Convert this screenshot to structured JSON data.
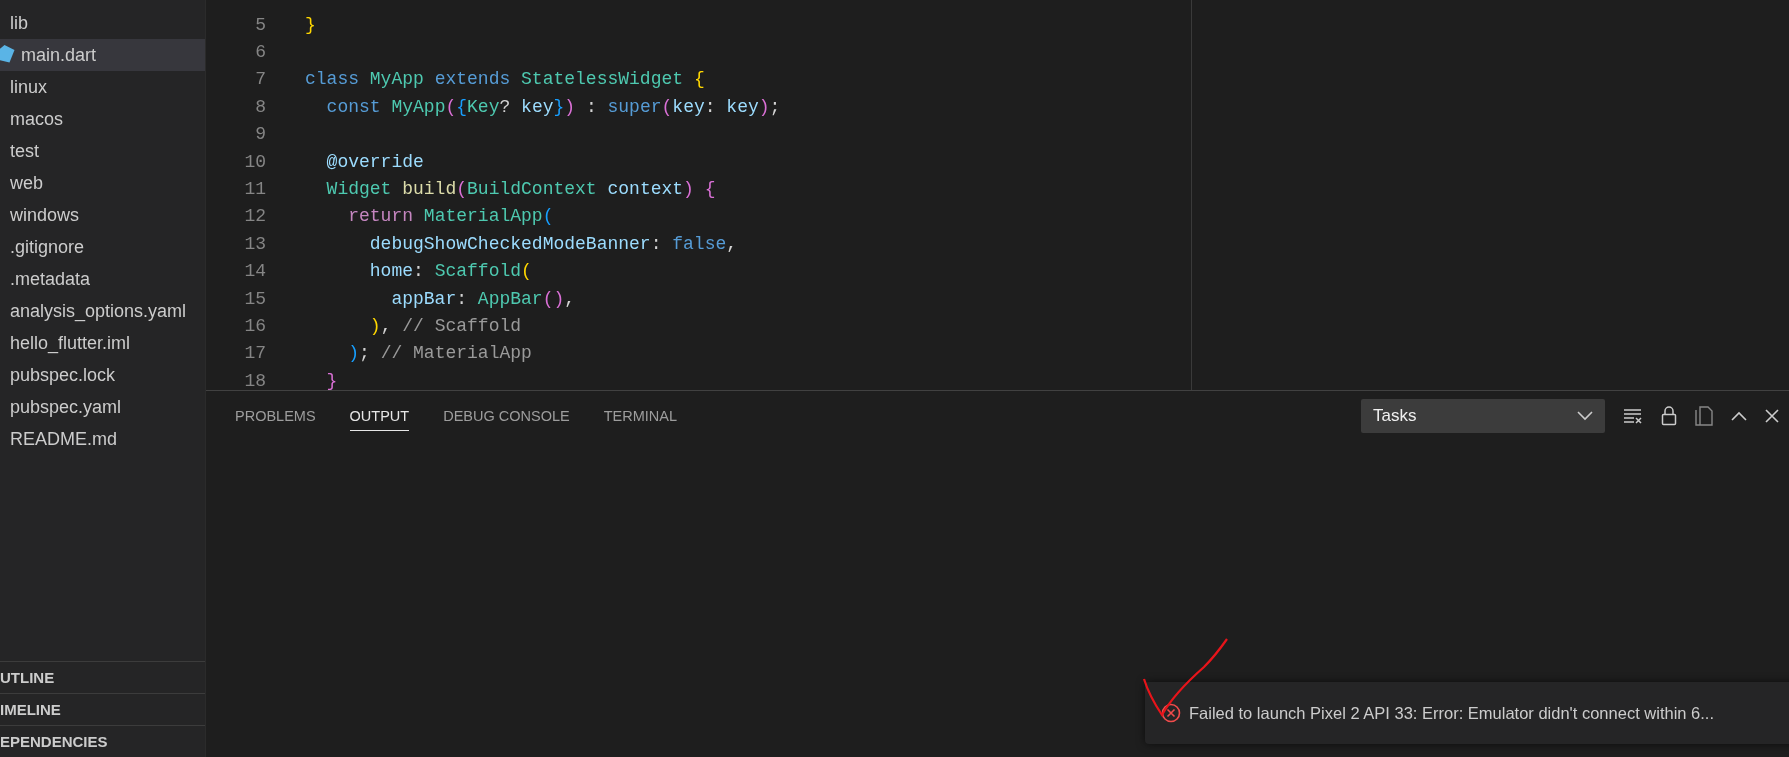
{
  "explorer": {
    "items": [
      {
        "label": "lib",
        "kind": "folder",
        "selected": false
      },
      {
        "label": "main.dart",
        "kind": "dart",
        "selected": true
      },
      {
        "label": "linux",
        "kind": "folder",
        "selected": false
      },
      {
        "label": "macos",
        "kind": "folder",
        "selected": false
      },
      {
        "label": "test",
        "kind": "folder",
        "selected": false
      },
      {
        "label": "web",
        "kind": "folder",
        "selected": false
      },
      {
        "label": "windows",
        "kind": "folder",
        "selected": false
      },
      {
        "label": ".gitignore",
        "kind": "file",
        "selected": false
      },
      {
        "label": ".metadata",
        "kind": "file",
        "selected": false
      },
      {
        "label": "analysis_options.yaml",
        "kind": "file",
        "selected": false
      },
      {
        "label": "hello_flutter.iml",
        "kind": "file",
        "selected": false
      },
      {
        "label": "pubspec.lock",
        "kind": "file",
        "selected": false
      },
      {
        "label": "pubspec.yaml",
        "kind": "file",
        "selected": false
      },
      {
        "label": "README.md",
        "kind": "file",
        "selected": false
      }
    ],
    "sections": [
      "UTLINE",
      "IMELINE",
      "EPENDENCIES"
    ]
  },
  "editor": {
    "lines": [
      {
        "number": "5",
        "tokens": [
          {
            "text": "}",
            "kind": "b1"
          }
        ]
      },
      {
        "number": "6"
      },
      {
        "number": "7",
        "tokens": [
          {
            "text": "class ",
            "kind": "keyword"
          },
          {
            "text": "MyApp ",
            "kind": "type"
          },
          {
            "text": "extends ",
            "kind": "keyword"
          },
          {
            "text": "StatelessWidget ",
            "kind": "type"
          },
          {
            "text": "{",
            "kind": "b1"
          }
        ]
      },
      {
        "number": "8",
        "tokens": [
          {
            "text": "  const ",
            "kind": "keyword"
          },
          {
            "text": "MyApp",
            "kind": "type"
          },
          {
            "text": "(",
            "kind": "b2"
          },
          {
            "text": "{",
            "kind": "b3"
          },
          {
            "text": "Key",
            "kind": "type"
          },
          {
            "text": "? ",
            "kind": "plain"
          },
          {
            "text": "key",
            "kind": "var"
          },
          {
            "text": "}",
            "kind": "b3"
          },
          {
            "text": ")",
            "kind": "b2"
          },
          {
            "text": " : ",
            "kind": "plain"
          },
          {
            "text": "super",
            "kind": "keyword"
          },
          {
            "text": "(",
            "kind": "b2"
          },
          {
            "text": "key",
            "kind": "var"
          },
          {
            "text": ": ",
            "kind": "plain"
          },
          {
            "text": "key",
            "kind": "var"
          },
          {
            "text": ")",
            "kind": "b2"
          },
          {
            "text": ";",
            "kind": "plain"
          }
        ]
      },
      {
        "number": "9"
      },
      {
        "number": "10",
        "tokens": [
          {
            "text": "  @override",
            "kind": "var"
          }
        ]
      },
      {
        "number": "11",
        "tokens": [
          {
            "text": "  Widget ",
            "kind": "type"
          },
          {
            "text": "build",
            "kind": "func"
          },
          {
            "text": "(",
            "kind": "b2"
          },
          {
            "text": "BuildContext ",
            "kind": "type"
          },
          {
            "text": "context",
            "kind": "var"
          },
          {
            "text": ")",
            "kind": "b2"
          },
          {
            "text": " {",
            "kind": "b2"
          }
        ]
      },
      {
        "number": "12",
        "tokens": [
          {
            "text": "    return ",
            "kind": "control"
          },
          {
            "text": "MaterialApp",
            "kind": "type"
          },
          {
            "text": "(",
            "kind": "b3"
          }
        ]
      },
      {
        "number": "13",
        "tokens": [
          {
            "text": "      debugShowCheckedModeBanner",
            "kind": "var"
          },
          {
            "text": ": ",
            "kind": "plain"
          },
          {
            "text": "false",
            "kind": "keyword"
          },
          {
            "text": ",",
            "kind": "plain"
          }
        ]
      },
      {
        "number": "14",
        "tokens": [
          {
            "text": "      home",
            "kind": "var"
          },
          {
            "text": ": ",
            "kind": "plain"
          },
          {
            "text": "Scaffold",
            "kind": "type"
          },
          {
            "text": "(",
            "kind": "b1"
          }
        ]
      },
      {
        "number": "15",
        "tokens": [
          {
            "text": "        appBar",
            "kind": "var"
          },
          {
            "text": ": ",
            "kind": "plain"
          },
          {
            "text": "AppBar",
            "kind": "type"
          },
          {
            "text": "()",
            "kind": "b2"
          },
          {
            "text": ",",
            "kind": "plain"
          }
        ]
      },
      {
        "number": "16",
        "tokens": [
          {
            "text": "      )",
            "kind": "b1"
          },
          {
            "text": ", ",
            "kind": "plain"
          },
          {
            "text": "// Scaffold",
            "kind": "comment"
          }
        ]
      },
      {
        "number": "17",
        "tokens": [
          {
            "text": "    )",
            "kind": "b3"
          },
          {
            "text": "; ",
            "kind": "plain"
          },
          {
            "text": "// MaterialApp",
            "kind": "comment"
          }
        ]
      },
      {
        "number": "18",
        "tokens": [
          {
            "text": "  }",
            "kind": "b2"
          }
        ]
      }
    ]
  },
  "panel": {
    "tabs": [
      {
        "label": "PROBLEMS",
        "selected": false
      },
      {
        "label": "OUTPUT",
        "selected": true
      },
      {
        "label": "DEBUG CONSOLE",
        "selected": false
      },
      {
        "label": "TERMINAL",
        "selected": false
      }
    ],
    "dropdown": {
      "value": "Tasks"
    }
  },
  "notification": {
    "kind": "error",
    "message": "Failed to launch Pixel 2 API 33: Error: Emulator didn't connect within 6..."
  }
}
